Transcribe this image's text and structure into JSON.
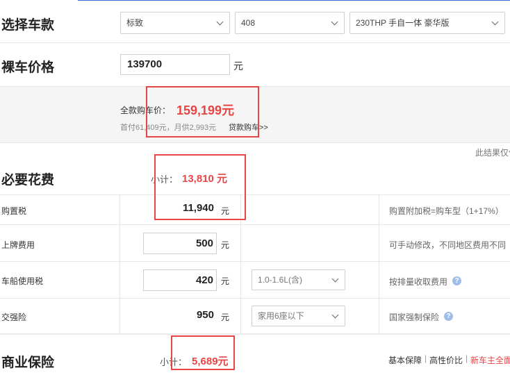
{
  "select_model": {
    "title": "选择车款",
    "brand": "标致",
    "series": "408",
    "trim": "230THP 手自一体 豪华版"
  },
  "bare_price": {
    "title": "裸车价格",
    "value": "139700",
    "unit": "元"
  },
  "summary": {
    "full_price_label": "全款购车价：",
    "full_price_value": "159,199元",
    "loan_text": "首付61,409元，月供2,993元",
    "loan_link": "贷款购车>>",
    "disclaimer": "此结果仅供"
  },
  "required": {
    "title": "必要花费",
    "subtotal_label": "小计：",
    "subtotal_value": "13,810 元",
    "rows": [
      {
        "name": "购置税",
        "value": "11,940",
        "unit": "元",
        "note": "购置附加税=购车型（1+17%）"
      },
      {
        "name": "上牌费用",
        "value": "500",
        "unit": "元",
        "note": "可手动修改，不同地区费用不同"
      },
      {
        "name": "车船使用税",
        "value": "420",
        "unit": "元",
        "option": "1.0-1.6L(含)",
        "note": "按排量收取费用"
      },
      {
        "name": "交强险",
        "value": "950",
        "unit": "元",
        "option": "家用6座以下",
        "note": "国家强制保险"
      }
    ]
  },
  "commercial": {
    "title": "商业保险",
    "subtotal_label": "小计：",
    "subtotal_value": "5,689元",
    "links": [
      "基本保障",
      "高性价比",
      "新车主全面"
    ],
    "separator": "|"
  },
  "colors": {
    "accent_red": "#e64545",
    "accent_blue": "#2f6fd6"
  }
}
